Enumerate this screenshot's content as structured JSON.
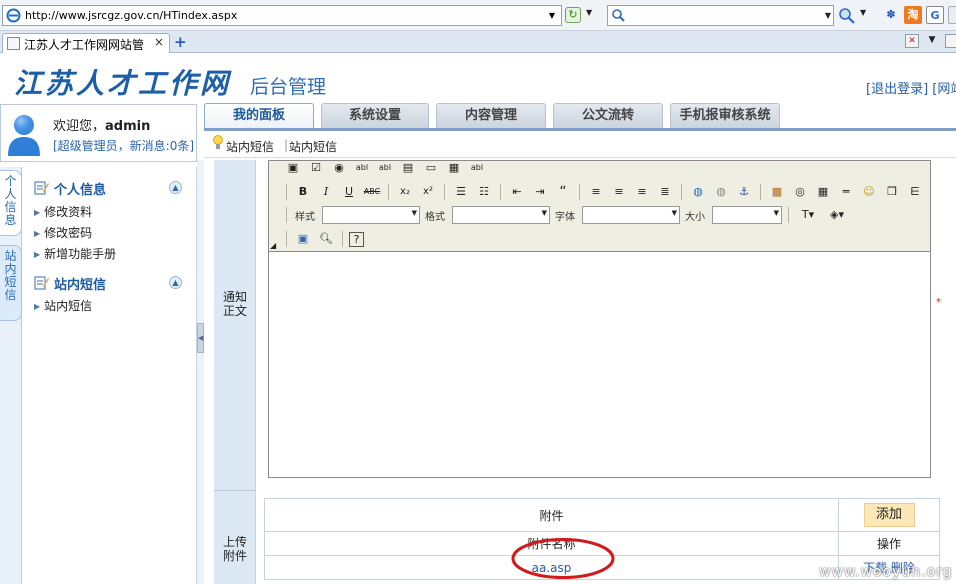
{
  "browser": {
    "url": "http://www.jsrcgz.gov.cn/HTindex.aspx",
    "tab_title": "江苏人才工作网网站管",
    "tab_close": "×",
    "new_tab": "+",
    "search_placeholder": ""
  },
  "header": {
    "logo_text": "江苏人才工作网",
    "admin_title": "后台管理",
    "links": "[退出登录] [网站"
  },
  "user": {
    "welcome": "欢迎您，",
    "username": "admin",
    "role_line": "[超级管理员，新消息:0条]"
  },
  "main_tabs": [
    {
      "label": "我的面板",
      "active": true
    },
    {
      "label": "系统设置",
      "active": false
    },
    {
      "label": "内容管理",
      "active": false
    },
    {
      "label": "公文流转",
      "active": false
    },
    {
      "label": "手机报审核系统",
      "active": false
    }
  ],
  "sub_nav": {
    "item1": "站内短信",
    "separator": "|",
    "item2": "站内短信"
  },
  "sidebar": {
    "vtabs": [
      "个人信息",
      "站内短信"
    ],
    "sections": [
      {
        "title": "个人信息",
        "items": [
          "修改资料",
          "修改密码",
          "新增功能手册"
        ]
      },
      {
        "title": "站内短信",
        "items": [
          "站内短信"
        ]
      }
    ]
  },
  "editor": {
    "style_label": "样式",
    "format_label": "格式",
    "font_label": "字体",
    "size_label": "大小"
  },
  "form": {
    "body_label": "通知正文",
    "upload_label": "上传附件",
    "required": "*"
  },
  "attachments": {
    "header": "附件",
    "add_button": "添加",
    "col_name": "附件名称",
    "col_ops": "操作",
    "rows": [
      {
        "name": "aa.asp",
        "download": "下载",
        "delete": "删除"
      }
    ]
  },
  "watermark": "www.wooyun.org",
  "colors": {
    "brand_blue": "#1b5fa8",
    "tab_active_text": "#1e5aa0",
    "add_button_bg": "#fbe7b8",
    "annotation_red": "#d11a1a"
  }
}
